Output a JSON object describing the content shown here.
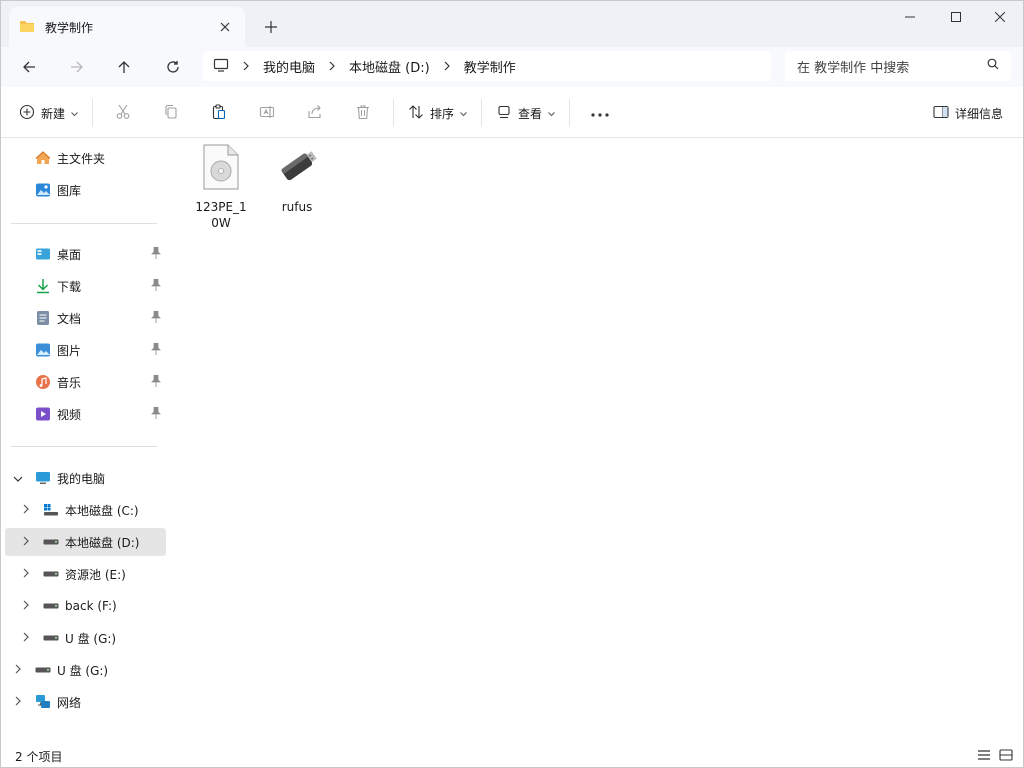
{
  "tab": {
    "title": "教学制作"
  },
  "address": {
    "crumbs": [
      "我的电脑",
      "本地磁盘 (D:)",
      "教学制作"
    ]
  },
  "search": {
    "placeholder": "在 教学制作 中搜索"
  },
  "toolbar": {
    "new_label": "新建",
    "sort_label": "排序",
    "view_label": "查看",
    "details_label": "详细信息"
  },
  "sidebar": {
    "top": [
      {
        "label": "主文件夹",
        "icon": "home-icon"
      },
      {
        "label": "图库",
        "icon": "gallery-icon"
      }
    ],
    "quick": [
      {
        "label": "桌面",
        "icon": "desktop-icon"
      },
      {
        "label": "下载",
        "icon": "download-icon"
      },
      {
        "label": "文档",
        "icon": "document-icon"
      },
      {
        "label": "图片",
        "icon": "pictures-icon"
      },
      {
        "label": "音乐",
        "icon": "music-icon"
      },
      {
        "label": "视频",
        "icon": "video-icon"
      }
    ],
    "pc": {
      "label": "我的电脑"
    },
    "drives": [
      {
        "label": "本地磁盘 (C:)"
      },
      {
        "label": "本地磁盘 (D:)"
      },
      {
        "label": "资源池 (E:)"
      },
      {
        "label": "back (F:)"
      },
      {
        "label": "U 盘 (G:)"
      }
    ],
    "usb": {
      "label": "U 盘 (G:)"
    },
    "network": {
      "label": "网络"
    }
  },
  "files": [
    {
      "name": "123PE_10W",
      "icon": "disc-image-file-icon"
    },
    {
      "name": "rufus",
      "icon": "usb-drive-app-icon"
    }
  ],
  "status": {
    "count": "2 个项目"
  },
  "colors": {
    "accent": "#0067c0",
    "folder": "#f4c04e",
    "selection": "#e5e5e5"
  }
}
